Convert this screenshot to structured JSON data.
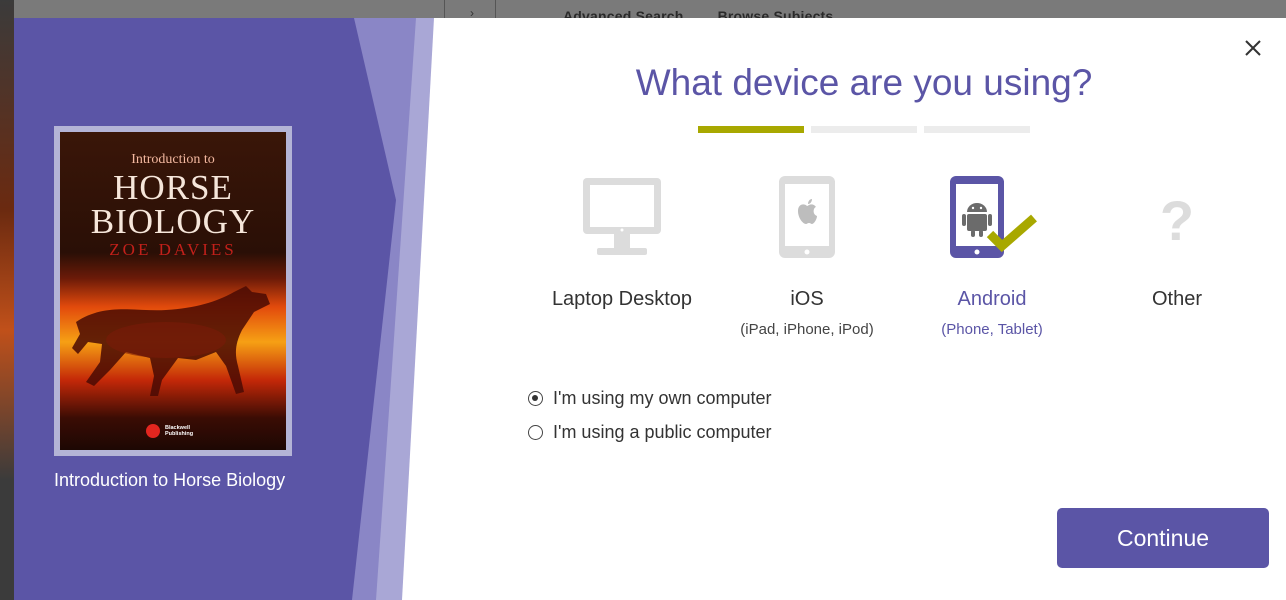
{
  "background_page": {
    "links": [
      "Advanced Search",
      "Browse Subjects"
    ]
  },
  "book": {
    "cover_subtitle": "Introduction to",
    "cover_title_line1": "HORSE",
    "cover_title_line2": "BIOLOGY",
    "cover_author": "ZOE DAVIES",
    "publisher_line1": "Blackwell",
    "publisher_line2": "Publishing",
    "title": "Introduction to Horse Biology"
  },
  "modal": {
    "heading": "What device are you using?",
    "close_symbol": "✕",
    "progress": {
      "total_steps": 3,
      "current_step": 1
    },
    "devices": [
      {
        "label": "Laptop Desktop",
        "sub": "",
        "icon": "monitor-icon",
        "selected": false
      },
      {
        "label": "iOS",
        "sub": "(iPad, iPhone, iPod)",
        "icon": "apple-tablet-icon",
        "selected": false
      },
      {
        "label": "Android",
        "sub": "(Phone, Tablet)",
        "icon": "android-phone-icon",
        "selected": true
      },
      {
        "label": "Other",
        "sub": "",
        "icon": "question-mark-icon",
        "selected": false
      }
    ],
    "computer_options": [
      {
        "label": "I'm using my own computer",
        "checked": true
      },
      {
        "label": "I'm using a public computer",
        "checked": false
      }
    ],
    "continue_label": "Continue"
  },
  "colors": {
    "accent_purple": "#5b55a6",
    "progress_active": "#a8a800",
    "progress_inactive": "#ececec",
    "check_mark": "#a8a800",
    "icon_gray": "#dcdcdc"
  }
}
